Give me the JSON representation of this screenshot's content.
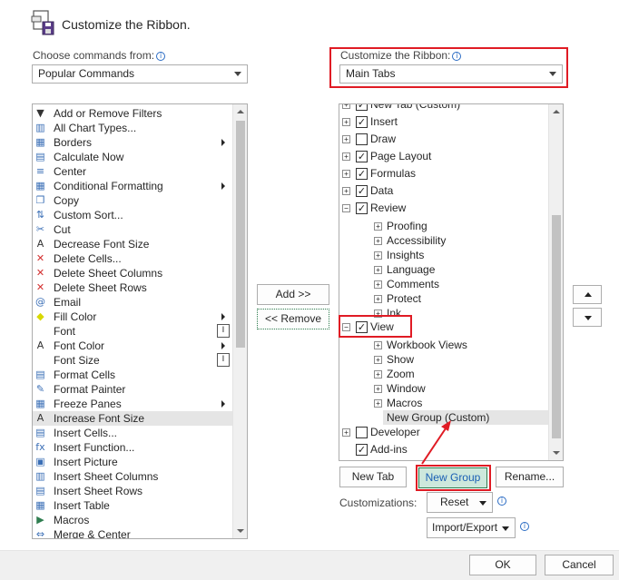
{
  "dialog": {
    "title": "Customize the Ribbon."
  },
  "left": {
    "choose_label": "Choose commands from:",
    "choose_value": "Popular Commands",
    "commands": [
      {
        "label": "Add or Remove Filters",
        "icon": "filter-icon",
        "glyph": "▼"
      },
      {
        "label": "All Chart Types...",
        "icon": "chart-icon",
        "glyph": "▥"
      },
      {
        "label": "Borders",
        "icon": "borders-icon",
        "glyph": "▦",
        "submenu": true
      },
      {
        "label": "Calculate Now",
        "icon": "calculator-icon",
        "glyph": "▤"
      },
      {
        "label": "Center",
        "icon": "align-center-icon",
        "glyph": "≡"
      },
      {
        "label": "Conditional Formatting",
        "icon": "conditional-formatting-icon",
        "glyph": "▦",
        "submenu": true
      },
      {
        "label": "Copy",
        "icon": "copy-icon",
        "glyph": "❐"
      },
      {
        "label": "Custom Sort...",
        "icon": "sort-icon",
        "glyph": "⇅"
      },
      {
        "label": "Cut",
        "icon": "scissors-icon",
        "glyph": "✂"
      },
      {
        "label": "Decrease Font Size",
        "icon": "decrease-font-icon",
        "glyph": "A"
      },
      {
        "label": "Delete Cells...",
        "icon": "delete-cells-icon",
        "glyph": "✕"
      },
      {
        "label": "Delete Sheet Columns",
        "icon": "delete-columns-icon",
        "glyph": "✕"
      },
      {
        "label": "Delete Sheet Rows",
        "icon": "delete-rows-icon",
        "glyph": "✕"
      },
      {
        "label": "Email",
        "icon": "email-attachment-icon",
        "glyph": "@"
      },
      {
        "label": "Fill Color",
        "icon": "fill-color-icon",
        "glyph": "◆",
        "submenu": true
      },
      {
        "label": "Font",
        "icon": "font-icon",
        "glyph": "",
        "side": "I"
      },
      {
        "label": "Font Color",
        "icon": "font-color-icon",
        "glyph": "A",
        "submenu": true
      },
      {
        "label": "Font Size",
        "icon": "font-size-icon",
        "glyph": "",
        "side": "I"
      },
      {
        "label": "Format Cells",
        "icon": "format-cells-icon",
        "glyph": "▤"
      },
      {
        "label": "Format Painter",
        "icon": "format-painter-icon",
        "glyph": "✎"
      },
      {
        "label": "Freeze Panes",
        "icon": "freeze-panes-icon",
        "glyph": "▦",
        "submenu": true
      },
      {
        "label": "Increase Font Size",
        "icon": "increase-font-icon",
        "glyph": "A"
      },
      {
        "label": "Insert Cells...",
        "icon": "insert-cells-icon",
        "glyph": "▤"
      },
      {
        "label": "Insert Function...",
        "icon": "function-icon",
        "glyph": "fx"
      },
      {
        "label": "Insert Picture",
        "icon": "picture-icon",
        "glyph": "▣"
      },
      {
        "label": "Insert Sheet Columns",
        "icon": "insert-columns-icon",
        "glyph": "▥"
      },
      {
        "label": "Insert Sheet Rows",
        "icon": "insert-rows-icon",
        "glyph": "▤"
      },
      {
        "label": "Insert Table",
        "icon": "table-icon",
        "glyph": "▦"
      },
      {
        "label": "Macros",
        "icon": "macro-icon",
        "glyph": "▶"
      },
      {
        "label": "Merge & Center",
        "icon": "merge-center-icon",
        "glyph": "⇔"
      }
    ]
  },
  "middle": {
    "add_label": "Add >>",
    "remove_label": "<< Remove"
  },
  "right": {
    "customize_label": "Customize the Ribbon:",
    "customize_value": "Main Tabs",
    "tabs": [
      {
        "label": "New Tab (Custom)",
        "level": 0,
        "expander": "+",
        "checked": true
      },
      {
        "label": "Insert",
        "level": 0,
        "expander": "+",
        "checked": true
      },
      {
        "label": "Draw",
        "level": 0,
        "expander": "+",
        "checked": false
      },
      {
        "label": "Page Layout",
        "level": 0,
        "expander": "+",
        "checked": true
      },
      {
        "label": "Formulas",
        "level": 0,
        "expander": "+",
        "checked": true
      },
      {
        "label": "Data",
        "level": 0,
        "expander": "+",
        "checked": true
      },
      {
        "label": "Review",
        "level": 0,
        "expander": "−",
        "checked": true
      },
      {
        "label": "Proofing",
        "level": 1,
        "expander": "+"
      },
      {
        "label": "Accessibility",
        "level": 1,
        "expander": "+"
      },
      {
        "label": "Insights",
        "level": 1,
        "expander": "+"
      },
      {
        "label": "Language",
        "level": 1,
        "expander": "+"
      },
      {
        "label": "Comments",
        "level": 1,
        "expander": "+"
      },
      {
        "label": "Protect",
        "level": 1,
        "expander": "+"
      },
      {
        "label": "Ink",
        "level": 1,
        "expander": "+"
      },
      {
        "label": "View",
        "level": 0,
        "expander": "−",
        "checked": true
      },
      {
        "label": "Workbook Views",
        "level": 1,
        "expander": "+"
      },
      {
        "label": "Show",
        "level": 1,
        "expander": "+"
      },
      {
        "label": "Zoom",
        "level": 1,
        "expander": "+"
      },
      {
        "label": "Window",
        "level": 1,
        "expander": "+"
      },
      {
        "label": "Macros",
        "level": 1,
        "expander": "+"
      },
      {
        "label": "New Group (Custom)",
        "level": 1,
        "expander": "",
        "selected": true
      },
      {
        "label": "Developer",
        "level": 0,
        "expander": "+",
        "checked": false
      },
      {
        "label": "Add-ins",
        "level": 0,
        "expander": "",
        "checked": true
      }
    ],
    "new_tab_label": "New Tab",
    "new_group_label": "New Group",
    "rename_label": "Rename...",
    "customizations_label": "Customizations:",
    "reset_label": "Reset",
    "import_export_label": "Import/Export"
  },
  "footer": {
    "ok_label": "OK",
    "cancel_label": "Cancel"
  },
  "colors": {
    "highlight": "#e01b24",
    "selection": "#e5e5e5",
    "new_group_fill": "#cde8dc",
    "accent": "#2b6cc4"
  }
}
